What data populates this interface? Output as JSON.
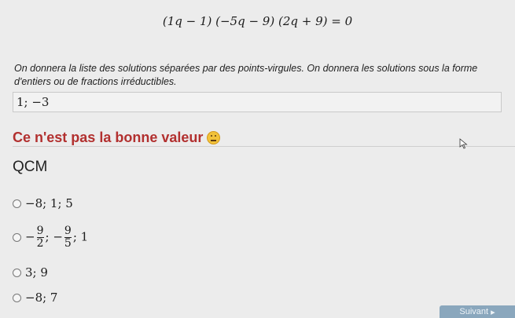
{
  "equation": "(1q − 1) (−5q − 9) (2q + 9) = 0",
  "instructions": "On donnera la liste des solutions séparées par des points-virgules. On donnera les solutions sous la forme d'entiers ou de fractions irréductibles.",
  "answer": {
    "value": "1; −3"
  },
  "feedback": {
    "text": "Ce n'est pas la bonne valeur",
    "icon": "frowning-face-icon",
    "color": "#b2302f"
  },
  "qcm": {
    "title": "QCM",
    "options": [
      {
        "label": "−8; 1; 5"
      },
      {
        "prefix": "−",
        "frac1": {
          "num": "9",
          "den": "2"
        },
        "sep1": "; −",
        "frac2": {
          "num": "9",
          "den": "5"
        },
        "suffix": "; 1"
      },
      {
        "label": "3; 9"
      },
      {
        "label": "−8; 7"
      }
    ]
  },
  "next_button": {
    "label": "Suivant"
  }
}
